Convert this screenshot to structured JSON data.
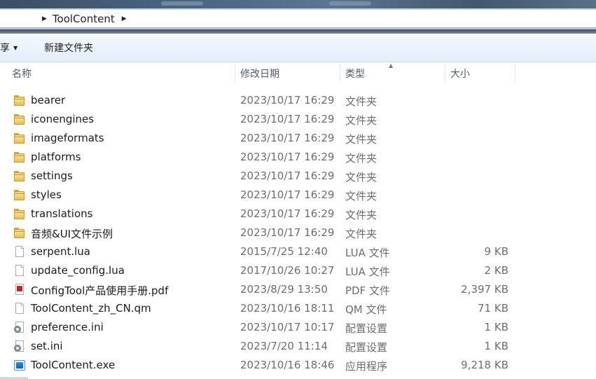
{
  "address": {
    "crumbs": [
      "ToolContent"
    ]
  },
  "toolbar": {
    "share_label": "共享",
    "new_folder_label": "新建文件夹"
  },
  "columns": {
    "name": "名称",
    "date": "修改日期",
    "type": "类型",
    "size": "大小"
  },
  "files": [
    {
      "name": "bearer",
      "date": "2023/10/17 16:29",
      "type": "文件夹",
      "size": "",
      "icon": "folder-icon"
    },
    {
      "name": "iconengines",
      "date": "2023/10/17 16:29",
      "type": "文件夹",
      "size": "",
      "icon": "folder-icon"
    },
    {
      "name": "imageformats",
      "date": "2023/10/17 16:29",
      "type": "文件夹",
      "size": "",
      "icon": "folder-icon"
    },
    {
      "name": "platforms",
      "date": "2023/10/17 16:29",
      "type": "文件夹",
      "size": "",
      "icon": "folder-icon"
    },
    {
      "name": "settings",
      "date": "2023/10/17 16:29",
      "type": "文件夹",
      "size": "",
      "icon": "folder-icon"
    },
    {
      "name": "styles",
      "date": "2023/10/17 16:29",
      "type": "文件夹",
      "size": "",
      "icon": "folder-icon"
    },
    {
      "name": "translations",
      "date": "2023/10/17 16:29",
      "type": "文件夹",
      "size": "",
      "icon": "folder-icon"
    },
    {
      "name": "音频&UI文件示例",
      "date": "2023/10/17 16:29",
      "type": "文件夹",
      "size": "",
      "icon": "folder-icon"
    },
    {
      "name": "serpent.lua",
      "date": "2015/7/25 12:40",
      "type": "LUA 文件",
      "size": "9 KB",
      "icon": "document-icon"
    },
    {
      "name": "update_config.lua",
      "date": "2017/10/26 10:27",
      "type": "LUA 文件",
      "size": "2 KB",
      "icon": "document-icon"
    },
    {
      "name": "ConfigTool产品使用手册.pdf",
      "date": "2023/8/29 13:50",
      "type": "PDF 文件",
      "size": "2,397 KB",
      "icon": "pdf-icon"
    },
    {
      "name": "ToolContent_zh_CN.qm",
      "date": "2023/10/16 18:11",
      "type": "QM 文件",
      "size": "71 KB",
      "icon": "document-icon"
    },
    {
      "name": "preference.ini",
      "date": "2023/10/17 10:17",
      "type": "配置设置",
      "size": "1 KB",
      "icon": "settings-file-icon"
    },
    {
      "name": "set.ini",
      "date": "2023/7/20 11:14",
      "type": "配置设置",
      "size": "1 KB",
      "icon": "settings-file-icon"
    },
    {
      "name": "ToolContent.exe",
      "date": "2023/10/16 18:46",
      "type": "应用程序",
      "size": "9,218 KB",
      "icon": "application-icon"
    }
  ]
}
